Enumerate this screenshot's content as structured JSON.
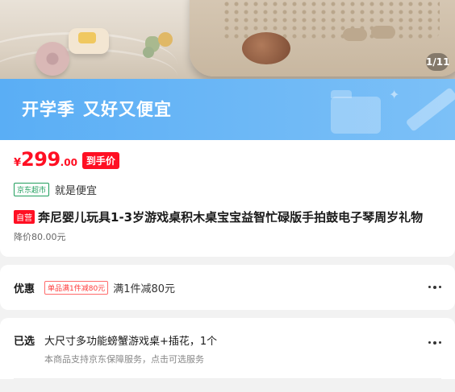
{
  "hero": {
    "page_indicator": "1/11"
  },
  "banner": {
    "slogan_main": "开学季",
    "slogan_sub": "又好又便宜"
  },
  "product": {
    "price": {
      "currency": "¥",
      "integer": "299",
      "decimal": ".00",
      "tag": "到手价"
    },
    "store_badge": "京东超市",
    "store_slogan": "就是便宜",
    "self_operated_tag": "自营",
    "title": "奔尼婴儿玩具1-3岁游戏桌积木桌宝宝益智忙碌版手拍鼓电子琴周岁礼物",
    "price_drop": "降价80.00元"
  },
  "promotion": {
    "label": "优惠",
    "tag": "单品满1件减80元",
    "text": "满1件减80元"
  },
  "selection": {
    "label": "已选",
    "value": "大尺寸多功能螃蟹游戏桌+插花，1个",
    "sub": "本商品支持京东保障服务，点击可选服务"
  },
  "colors": {
    "price_red": "#ff0f23",
    "banner_blue": "#5aaef5",
    "jd_green": "#1f9e5c"
  }
}
